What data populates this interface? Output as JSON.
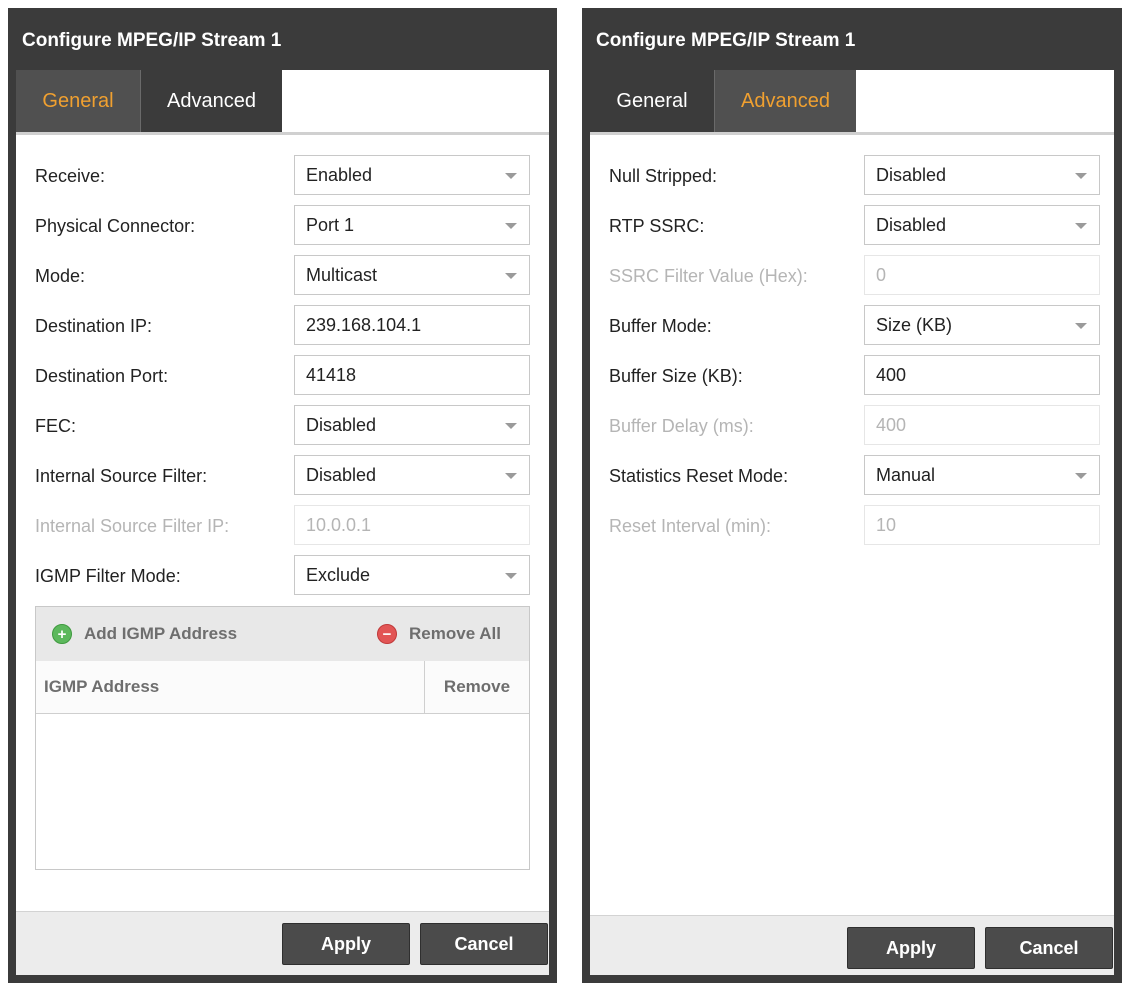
{
  "dialog_general": {
    "title": "Configure MPEG/IP Stream 1",
    "tabs": {
      "general": "General",
      "advanced": "Advanced",
      "active": "General"
    },
    "fields": [
      {
        "label": "Receive:",
        "value": "Enabled",
        "type": "select",
        "enabled": true
      },
      {
        "label": "Physical Connector:",
        "value": "Port 1",
        "type": "select",
        "enabled": true
      },
      {
        "label": "Mode:",
        "value": "Multicast",
        "type": "select",
        "enabled": true
      },
      {
        "label": "Destination IP:",
        "value": "239.168.104.1",
        "type": "text",
        "enabled": true
      },
      {
        "label": "Destination Port:",
        "value": "41418",
        "type": "text",
        "enabled": true
      },
      {
        "label": "FEC:",
        "value": "Disabled",
        "type": "select",
        "enabled": true
      },
      {
        "label": "Internal Source Filter:",
        "value": "Disabled",
        "type": "select",
        "enabled": true
      },
      {
        "label": "Internal Source Filter IP:",
        "value": "10.0.0.1",
        "type": "text",
        "enabled": false
      },
      {
        "label": "IGMP Filter Mode:",
        "value": "Exclude",
        "type": "select",
        "enabled": true
      }
    ],
    "igmp": {
      "add_label": "Add IGMP Address",
      "remove_all_label": "Remove All",
      "columns": [
        "IGMP Address",
        "Remove"
      ],
      "rows": []
    },
    "buttons": {
      "apply": "Apply",
      "cancel": "Cancel"
    }
  },
  "dialog_advanced": {
    "title": "Configure MPEG/IP Stream 1",
    "tabs": {
      "general": "General",
      "advanced": "Advanced",
      "active": "Advanced"
    },
    "fields": [
      {
        "label": "Null Stripped:",
        "value": "Disabled",
        "type": "select",
        "enabled": true
      },
      {
        "label": "RTP SSRC:",
        "value": "Disabled",
        "type": "select",
        "enabled": true
      },
      {
        "label": "SSRC Filter Value (Hex):",
        "value": "0",
        "type": "text",
        "enabled": false
      },
      {
        "label": "Buffer Mode:",
        "value": "Size (KB)",
        "type": "select",
        "enabled": true
      },
      {
        "label": "Buffer Size (KB):",
        "value": "400",
        "type": "text",
        "enabled": true
      },
      {
        "label": "Buffer Delay (ms):",
        "value": "400",
        "type": "text",
        "enabled": false
      },
      {
        "label": "Statistics Reset Mode:",
        "value": "Manual",
        "type": "select",
        "enabled": true
      },
      {
        "label": "Reset Interval (min):",
        "value": "10",
        "type": "text",
        "enabled": false
      }
    ],
    "buttons": {
      "apply": "Apply",
      "cancel": "Cancel"
    }
  },
  "colors": {
    "dialog_bg": "#3b3b3b",
    "active_tab_text": "#f0a030",
    "disabled_text": "#b5b5b5",
    "add_icon": "#5cb85c",
    "remove_icon": "#e25555"
  },
  "icons": {
    "add": "plus-circle-icon",
    "remove_all": "minus-circle-icon",
    "dropdown": "chevron-down-icon"
  }
}
